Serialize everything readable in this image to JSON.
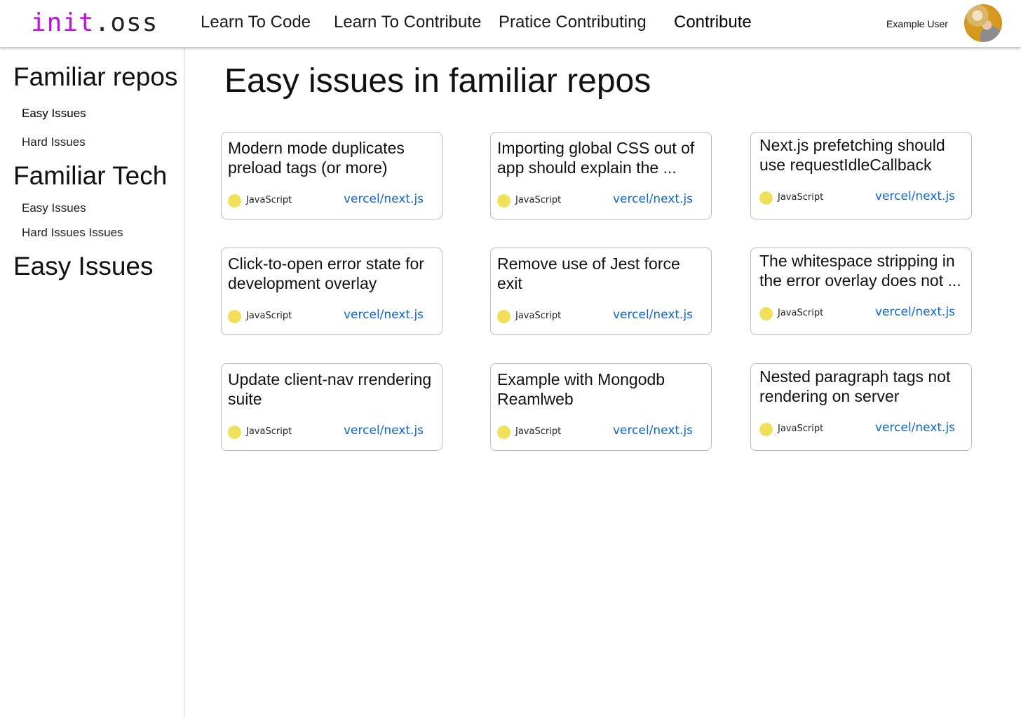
{
  "header": {
    "logo_part1": "init",
    "logo_part2": ".oss",
    "nav": [
      {
        "label": "Learn To Code"
      },
      {
        "label": "Learn To Contribute"
      },
      {
        "label": "Pratice Contributing"
      },
      {
        "label": "Contribute",
        "active": true
      }
    ],
    "user_name": "Example User"
  },
  "sidebar": {
    "sections": [
      {
        "heading": "Familiar repos",
        "items": [
          {
            "label": "Easy Issues",
            "active": true
          },
          {
            "label": "Hard Issues"
          }
        ]
      },
      {
        "heading": "Familiar Tech",
        "items": [
          {
            "label": "Easy Issues"
          },
          {
            "label": "Hard Issues Issues"
          }
        ]
      },
      {
        "heading": "Easy Issues",
        "items": []
      }
    ]
  },
  "main": {
    "title": "Easy issues in familiar repos",
    "issues": [
      {
        "title": "Modern mode duplicates preload tags (or more)",
        "language": "JavaScript",
        "repo": "vercel/next.js"
      },
      {
        "title": "Importing global CSS out of app should explain the ...",
        "language": "JavaScript",
        "repo": "vercel/next.js"
      },
      {
        "title": "Next.js prefetching should use requestIdleCallback",
        "language": "JavaScript",
        "repo": "vercel/next.js"
      },
      {
        "title": "Click-to-open error state for development overlay",
        "language": "JavaScript",
        "repo": "vercel/next.js"
      },
      {
        "title": "Remove use of Jest force exit",
        "language": "JavaScript",
        "repo": "vercel/next.js"
      },
      {
        "title": "The whitespace stripping in the error overlay does not ...",
        "language": "JavaScript",
        "repo": "vercel/next.js"
      },
      {
        "title": "Update client-nav rrendering suite",
        "language": "JavaScript",
        "repo": "vercel/next.js"
      },
      {
        "title": "Example with Mongodb Reamlweb",
        "language": "JavaScript",
        "repo": "vercel/next.js"
      },
      {
        "title": "Nested paragraph tags not rendering on server",
        "language": "JavaScript",
        "repo": "vercel/next.js"
      }
    ]
  },
  "colors": {
    "logo_accent": "#c20fe0",
    "javascript_dot": "#f1e05a",
    "repo_link": "#0b66d6"
  }
}
